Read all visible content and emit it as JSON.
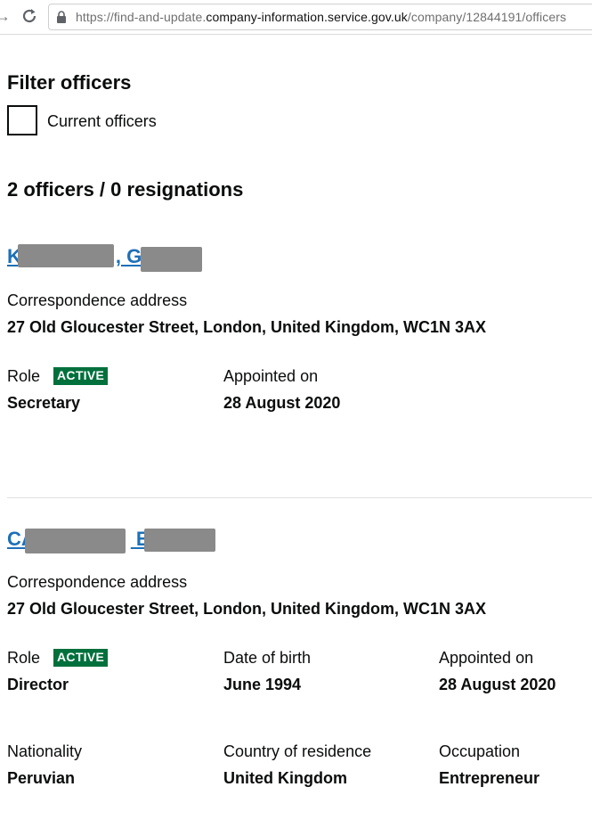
{
  "browser": {
    "url_prefix": "https://find-and-update.",
    "url_domain": "company-information.service.gov.uk",
    "url_path": "/company/12844191/officers"
  },
  "filter": {
    "heading": "Filter officers",
    "current_label": "Current officers"
  },
  "summary": "2 officers / 0 resignations",
  "officers": [
    {
      "name_visible_start": "K",
      "name_visible_mid": ", G",
      "address_label": "Correspondence address",
      "address": "27 Old Gloucester Street, London, United Kingdom, WC1N 3AX",
      "role_label": "Role",
      "status": "ACTIVE",
      "role": "Secretary",
      "appointed_label": "Appointed on",
      "appointed": "28 August 2020"
    },
    {
      "name_visible_start": "CA",
      "name_visible_mid": " E",
      "address_label": "Correspondence address",
      "address": "27 Old Gloucester Street, London, United Kingdom, WC1N 3AX",
      "role_label": "Role",
      "status": "ACTIVE",
      "role": "Director",
      "dob_label": "Date of birth",
      "dob": "June 1994",
      "appointed_label": "Appointed on",
      "appointed": "28 August 2020",
      "nationality_label": "Nationality",
      "nationality": "Peruvian",
      "residence_label": "Country of residence",
      "residence": "United Kingdom",
      "occupation_label": "Occupation",
      "occupation": "Entrepreneur"
    }
  ],
  "colors": {
    "link": "#1d70b8",
    "badge": "#00703c",
    "redaction": "#8a8a8a"
  }
}
